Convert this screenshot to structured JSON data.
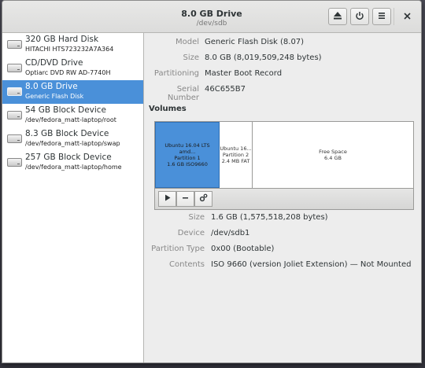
{
  "window": {
    "title": "8.0 GB Drive",
    "subtitle": "/dev/sdb"
  },
  "header": {
    "eject_icon": "eject-icon",
    "power_icon": "power-icon",
    "menu_icon": "menu-icon",
    "close_icon": "close-icon"
  },
  "drives": [
    {
      "name": "320 GB Hard Disk",
      "sub": "HITACHI HTS723232A7A364",
      "selected": false
    },
    {
      "name": "CD/DVD Drive",
      "sub": "Optiarc DVD RW AD-7740H",
      "selected": false
    },
    {
      "name": "8.0 GB Drive",
      "sub": "Generic Flash Disk",
      "selected": true
    },
    {
      "name": "54 GB Block Device",
      "sub": "/dev/fedora_matt-laptop/root",
      "selected": false
    },
    {
      "name": "8.3 GB Block Device",
      "sub": "/dev/fedora_matt-laptop/swap",
      "selected": false
    },
    {
      "name": "257 GB Block Device",
      "sub": "/dev/fedora_matt-laptop/home",
      "selected": false
    }
  ],
  "drive_info": {
    "model_label": "Model",
    "model": "Generic Flash Disk (8.07)",
    "size_label": "Size",
    "size": "8.0 GB (8,019,509,248 bytes)",
    "partitioning_label": "Partitioning",
    "partitioning": "Master Boot Record",
    "serial_label": "Serial Number",
    "serial": "46C655B7"
  },
  "volumes": {
    "heading": "Volumes",
    "partitions": [
      {
        "line1": "Ubuntu 16.04 LTS amd...",
        "line2": "Partition 1",
        "line3": "1.6 GB ISO9660",
        "selected": true
      },
      {
        "line1": "Ubuntu 16...",
        "line2": "Partition 2",
        "line3": "2.4 MB FAT",
        "selected": false
      },
      {
        "line1": "Free Space",
        "line2": "6.4 GB",
        "line3": "",
        "selected": false
      }
    ]
  },
  "volume_info": {
    "size_label": "Size",
    "size": "1.6 GB (1,575,518,208 bytes)",
    "device_label": "Device",
    "device": "/dev/sdb1",
    "ptype_label": "Partition Type",
    "ptype": "0x00 (Bootable)",
    "contents_label": "Contents",
    "contents": "ISO 9660 (version Joliet Extension) — Not Mounted"
  },
  "colors": {
    "accent": "#4a90d9",
    "header_bg": "#dcdcdb",
    "sidebar_bg": "#ffffff"
  }
}
